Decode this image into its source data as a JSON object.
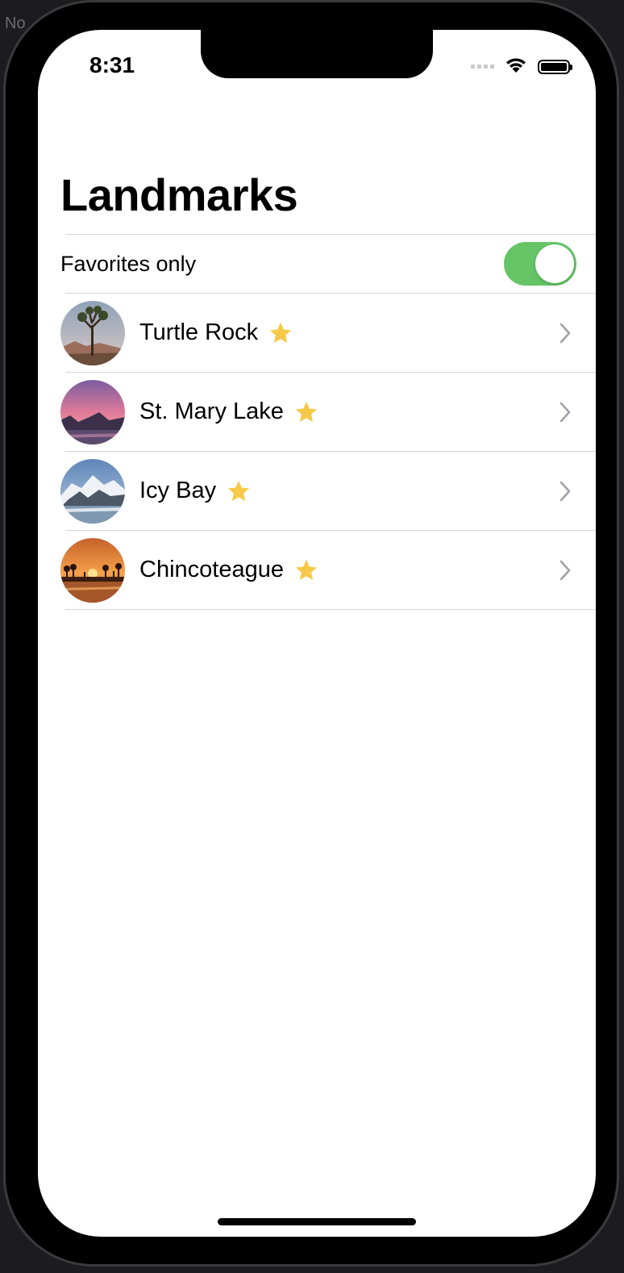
{
  "backdrop": {
    "text": "No"
  },
  "status_bar": {
    "time": "8:31"
  },
  "page_title": "Landmarks",
  "filter": {
    "label": "Favorites only",
    "enabled": true
  },
  "landmarks": [
    {
      "name": "Turtle Rock",
      "favorite": true
    },
    {
      "name": "St. Mary Lake",
      "favorite": true
    },
    {
      "name": "Icy Bay",
      "favorite": true
    },
    {
      "name": "Chincoteague",
      "favorite": true
    }
  ],
  "colors": {
    "toggle_on": "#65c466",
    "star": "#f7c948",
    "chevron": "#a1a1a6",
    "divider": "#d6d6da"
  }
}
